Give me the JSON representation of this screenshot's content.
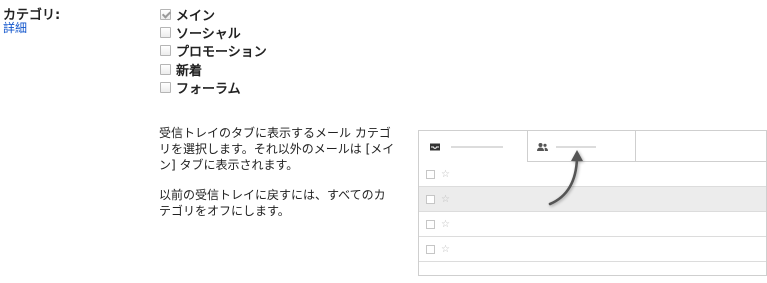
{
  "category": {
    "label": "カテゴリ:",
    "details_link": "詳細"
  },
  "options": [
    {
      "label": "メイン",
      "checked": true,
      "disabled": true
    },
    {
      "label": "ソーシャル",
      "checked": false
    },
    {
      "label": "プロモーション",
      "checked": false
    },
    {
      "label": "新着",
      "checked": false
    },
    {
      "label": "フォーラム",
      "checked": false
    }
  ],
  "description": {
    "paragraph1": "受信トレイのタブに表示するメール カテゴリを選択します。それ以外のメールは [メイン] タブに表示されます。",
    "paragraph2": "以前の受信トレイに戻すには、すべてのカテゴリをオフにします。"
  },
  "preview": {
    "tabs": [
      {
        "icon": "inbox-icon"
      },
      {
        "icon": "people-icon"
      }
    ],
    "rows": [
      {
        "star": "☆",
        "shaded": false
      },
      {
        "star": "☆",
        "shaded": true
      },
      {
        "star": "☆",
        "shaded": false
      },
      {
        "star": "☆",
        "shaded": false
      }
    ]
  }
}
